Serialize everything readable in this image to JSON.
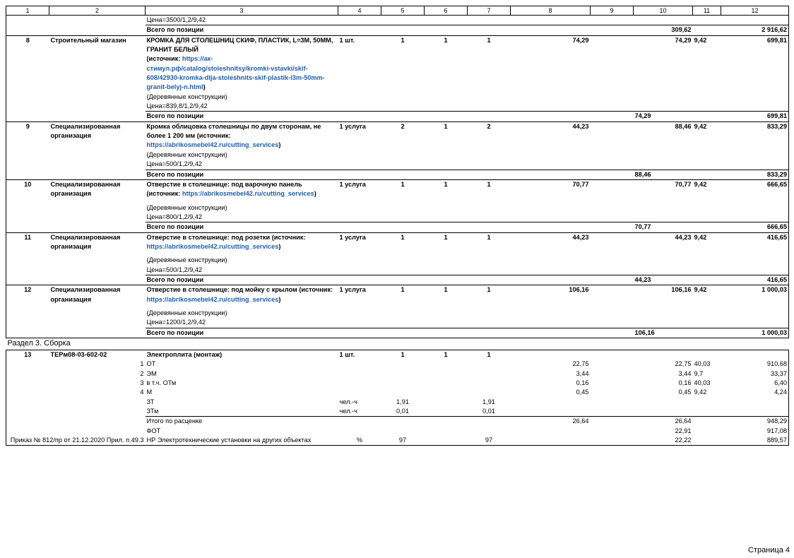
{
  "header": [
    "1",
    "2",
    "3",
    "4",
    "5",
    "6",
    "7",
    "8",
    "9",
    "10",
    "11",
    "12"
  ],
  "top": {
    "price": "Цена=3500/1,2/9,42",
    "total_label": "Всего по позиции",
    "total_c10": "309,62",
    "total_c12": "2 916,62"
  },
  "r8": {
    "n": "8",
    "source": "Строительный магазин",
    "title": "КРОМКА ДЛЯ СТОЛЕШНИЦ СКИФ, ПЛАСТИК, L=3М, 50ММ, ГРАНИТ БЕЛЫЙ",
    "src_prefix": "(источник: ",
    "url": "https://ак-стимул.рф/catalog/stoleshnitsy/kromki-vstavki/skif-608/42930-kromka-dlja-stoleshnits-skif-plastik-l3m-50mm-granit-belyj-n.html",
    "src_suffix": ")",
    "cat": "(Деревянные конструкции)",
    "price": "Цена=839,8/1,2/9,42",
    "unit": "1 шт.",
    "c5": "1",
    "c6": "1",
    "c7": "1",
    "c8": "74,29",
    "c10": "74,29",
    "c11": "9,42",
    "c12": "699,81",
    "total_label": "Всего по позиции",
    "total_c10": "74,29",
    "total_c12": "699,81"
  },
  "r9": {
    "n": "9",
    "source": "Специализированная организация",
    "title": "Кромка облицовка столешницы по двум сторонам, не более 1 200 мм (источник:",
    "url": "https://abrikosmebel42.ru/cutting_services",
    "src_suffix": ")",
    "cat": "(Деревянные конструкции)",
    "price": "Цена=500/1,2/9,42",
    "unit": "1 услуга",
    "c5": "2",
    "c6": "1",
    "c7": "2",
    "c8": "44,23",
    "c10": "88,46",
    "c11": "9,42",
    "c12": "833,29",
    "total_label": "Всего по позиции",
    "total_c10": "88,46",
    "total_c12": "833,29"
  },
  "r10": {
    "n": "10",
    "source": "Специализированная организация",
    "title": "Отверстие в столешнице: под варочную панель (источник: ",
    "url": "https://abrikosmebel42.ru/cutting_services",
    "src_suffix": ")",
    "cat": "(Деревянные конструкции)",
    "price": "Цена=800/1,2/9,42",
    "unit": "1 услуга",
    "c5": "1",
    "c6": "1",
    "c7": "1",
    "c8": "70,77",
    "c10": "70,77",
    "c11": "9,42",
    "c12": "666,65",
    "total_label": "Всего по позиции",
    "total_c10": "70,77",
    "total_c12": "666,65"
  },
  "r11": {
    "n": "11",
    "source": "Специализированная организация",
    "title": "Отверстие в столешнице: под розетки (источник:",
    "url": "https://abrikosmebel42.ru/cutting_services",
    "src_suffix": ")",
    "cat": "(Деревянные конструкции)",
    "price": "Цена=500/1,2/9,42",
    "unit": "1 услуга",
    "c5": "1",
    "c6": "1",
    "c7": "1",
    "c8": "44,23",
    "c10": "44,23",
    "c11": "9,42",
    "c12": "416,65",
    "total_label": "Всего по позиции",
    "total_c10": "44,23",
    "total_c12": "416,65"
  },
  "r12": {
    "n": "12",
    "source": "Специализированная организация",
    "title": "Отверстие в столешнице: под мойку с крылом (источник: ",
    "url": "https://abrikosmebel42.ru/cutting_services",
    "src_suffix": ")",
    "cat": "(Деревянные конструкции)",
    "price": "Цена=1200/1,2/9,42",
    "unit": "1 услуга",
    "c5": "1",
    "c6": "1",
    "c7": "1",
    "c8": "106,16",
    "c10": "106,16",
    "c11": "9,42",
    "c12": "1 000,03",
    "total_label": "Всего по позиции",
    "total_c10": "106,16",
    "total_c12": "1 000,03"
  },
  "section3": "Раздел 3. Сборка",
  "r13": {
    "n": "13",
    "code": "ТЕРм08-03-602-02",
    "title": "Электроплита (монтаж)",
    "unit": "1 шт.",
    "c5": "1",
    "c6": "1",
    "c7": "1",
    "sub": [
      {
        "idx": "1",
        "label": "ОТ",
        "c8": "22,75",
        "c10": "22,75",
        "c11": "40,03",
        "c12": "910,68"
      },
      {
        "idx": "2",
        "label": "ЭМ",
        "c8": "3,44",
        "c10": "3,44",
        "c11": "9,7",
        "c12": "33,37"
      },
      {
        "idx": "3",
        "label": "в т.ч. ОТм",
        "c8": "0,16",
        "c10": "0,16",
        "c11": "40,03",
        "c12": "6,40"
      },
      {
        "idx": "4",
        "label": "М",
        "c8": "0,45",
        "c10": "0,45",
        "c11": "9,42",
        "c12": "4,24"
      }
    ],
    "labor": [
      {
        "label": "ЗТ",
        "unit": "чел.-ч",
        "c5": "1,91",
        "c7": "1,91"
      },
      {
        "label": "ЗТм",
        "unit": "чел.-ч",
        "c5": "0,01",
        "c7": "0,01"
      }
    ],
    "itogo": {
      "label": "Итого по расценке",
      "c8": "26,64",
      "c10": "26,64",
      "c12": "948,29"
    },
    "fot": {
      "label": "ФОТ",
      "c10": "22,91",
      "c12": "917,08"
    },
    "nr": {
      "basis": "Приказ № 812/пр от 21.12.2020 Прил. п.49.3",
      "label": "НР Электротехнические установки на других объектах",
      "unit": "%",
      "c5": "97",
      "c7": "97",
      "c10": "22,22",
      "c12": "889,57"
    }
  },
  "footer": {
    "page": "Страница 4"
  }
}
